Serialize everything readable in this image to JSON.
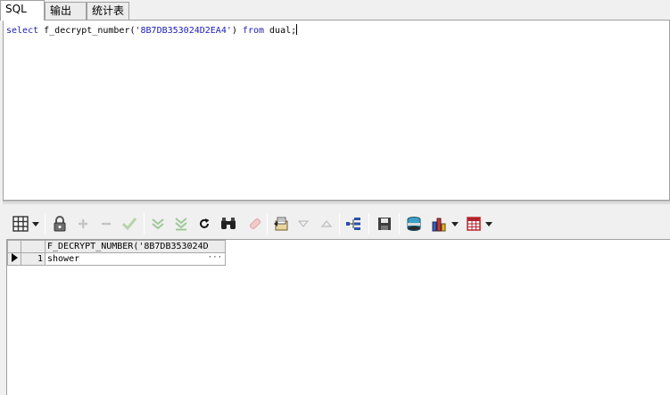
{
  "tabs": [
    {
      "label": "SQL",
      "active": true
    },
    {
      "label": "输出",
      "active": false
    },
    {
      "label": "统计表",
      "active": false
    }
  ],
  "editor": {
    "kw_select": "select",
    "fn_call": " f_decrypt_number(",
    "arg": "'8B7DB353024D2EA4'",
    "close": ") ",
    "kw_from": "from",
    "tail": " dual;"
  },
  "toolbar_icons": [
    "grid-view-icon",
    "dropdown-arrow-icon",
    "lock-icon",
    "add-record-icon",
    "delete-record-icon",
    "post-changes-icon",
    "fetch-next-icon",
    "fetch-last-icon",
    "refresh-icon",
    "find-icon",
    "clear-icon",
    "export-icon",
    "sort-desc-icon",
    "sort-asc-icon",
    "query-tree-icon",
    "save-icon",
    "database-icon",
    "chart-icon",
    "dropdown-arrow-icon",
    "table-icon",
    "dropdown-arrow-icon"
  ],
  "grid": {
    "column_header": "F_DECRYPT_NUMBER('8B7DB353024D",
    "rows": [
      {
        "num": "1",
        "value": "shower",
        "ellipsis": "···"
      }
    ]
  },
  "colors": {
    "keyword": "#1a1ab8",
    "background": "#f0f0f0"
  }
}
